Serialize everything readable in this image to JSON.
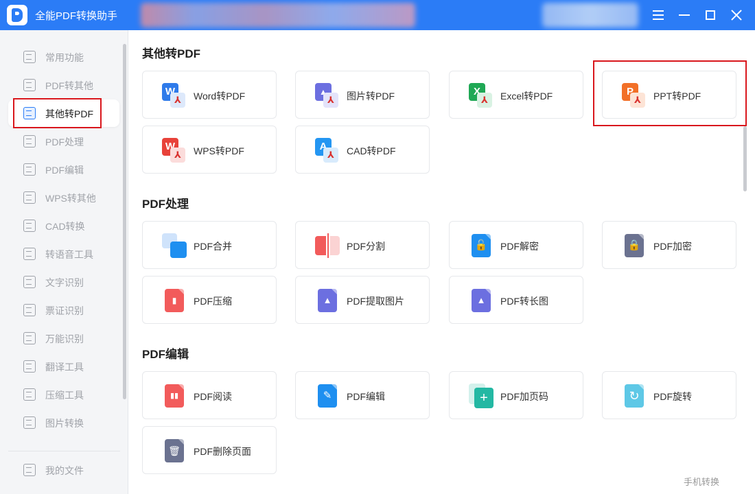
{
  "app": {
    "title": "全能PDF转换助手"
  },
  "window_controls": [
    "menu-icon",
    "minimize-icon",
    "maximize-icon",
    "close-icon"
  ],
  "sidebar": {
    "items": [
      {
        "label": "常用功能",
        "icon": "star-icon"
      },
      {
        "label": "PDF转其他",
        "icon": "pdf-convert-icon"
      },
      {
        "label": "其他转PDF",
        "icon": "convert-to-pdf-icon",
        "active": true
      },
      {
        "label": "PDF处理",
        "icon": "pdf-process-icon"
      },
      {
        "label": "PDF编辑",
        "icon": "pdf-edit-icon"
      },
      {
        "label": "WPS转其他",
        "icon": "wps-icon"
      },
      {
        "label": "CAD转换",
        "icon": "cad-icon"
      },
      {
        "label": "转语音工具",
        "icon": "voice-icon"
      },
      {
        "label": "文字识别",
        "icon": "text-ocr-icon"
      },
      {
        "label": "票证识别",
        "icon": "ticket-ocr-icon"
      },
      {
        "label": "万能识别",
        "icon": "eye-icon"
      },
      {
        "label": "翻译工具",
        "icon": "translate-icon"
      },
      {
        "label": "压缩工具",
        "icon": "zip-icon"
      },
      {
        "label": "图片转换",
        "icon": "image-icon"
      }
    ],
    "my_files": "我的文件"
  },
  "sections": [
    {
      "title": "其他转PDF",
      "cards": [
        {
          "label": "Word转PDF",
          "icon": "word-icon",
          "letter": "W",
          "color": "#2f7bea"
        },
        {
          "label": "图片转PDF",
          "icon": "image-icon",
          "letter": "▲",
          "color": "#6c6fe0"
        },
        {
          "label": "Excel转PDF",
          "icon": "excel-icon",
          "letter": "X",
          "color": "#1fa855"
        },
        {
          "label": "PPT转PDF",
          "icon": "ppt-icon",
          "letter": "P",
          "color": "#f27028",
          "highlighted": true
        },
        {
          "label": "WPS转PDF",
          "icon": "wps-icon",
          "letter": "W",
          "color": "#e8423a"
        },
        {
          "label": "CAD转PDF",
          "icon": "cad-icon",
          "letter": "A",
          "color": "#2496f2"
        }
      ]
    },
    {
      "title": "PDF处理",
      "cards": [
        {
          "label": "PDF合并",
          "icon": "merge-icon",
          "color": "#1e8ff0"
        },
        {
          "label": "PDF分割",
          "icon": "split-icon",
          "color": "#f25b5b"
        },
        {
          "label": "PDF解密",
          "icon": "unlock-icon",
          "glyph": "🔓",
          "color": "#1e8ff0"
        },
        {
          "label": "PDF加密",
          "icon": "lock-icon",
          "glyph": "🔒",
          "color": "#6b7290"
        },
        {
          "label": "PDF压缩",
          "icon": "compress-icon",
          "glyph": "▮",
          "color": "#f25b5b"
        },
        {
          "label": "PDF提取图片",
          "icon": "extract-image-icon",
          "glyph": "▲",
          "color": "#6c6fe0"
        },
        {
          "label": "PDF转长图",
          "icon": "long-image-icon",
          "glyph": "▲",
          "color": "#6c6fe0"
        }
      ]
    },
    {
      "title": "PDF编辑",
      "cards": [
        {
          "label": "PDF阅读",
          "icon": "book-icon",
          "glyph": "▮▮",
          "color": "#f25b5b"
        },
        {
          "label": "PDF编辑",
          "icon": "pencil-icon",
          "glyph": "✎",
          "color": "#1e8ff0"
        },
        {
          "label": "PDF加页码",
          "icon": "plus-icon",
          "glyph": "+",
          "color": "#23b8a3"
        },
        {
          "label": "PDF旋转",
          "icon": "rotate-icon",
          "glyph": "↻",
          "color": "#5ec8e6"
        },
        {
          "label": "PDF删除页面",
          "icon": "trash-icon",
          "glyph": "🗑",
          "color": "#6b7290"
        }
      ]
    }
  ],
  "footer": {
    "mobile_convert": "手机转换"
  }
}
